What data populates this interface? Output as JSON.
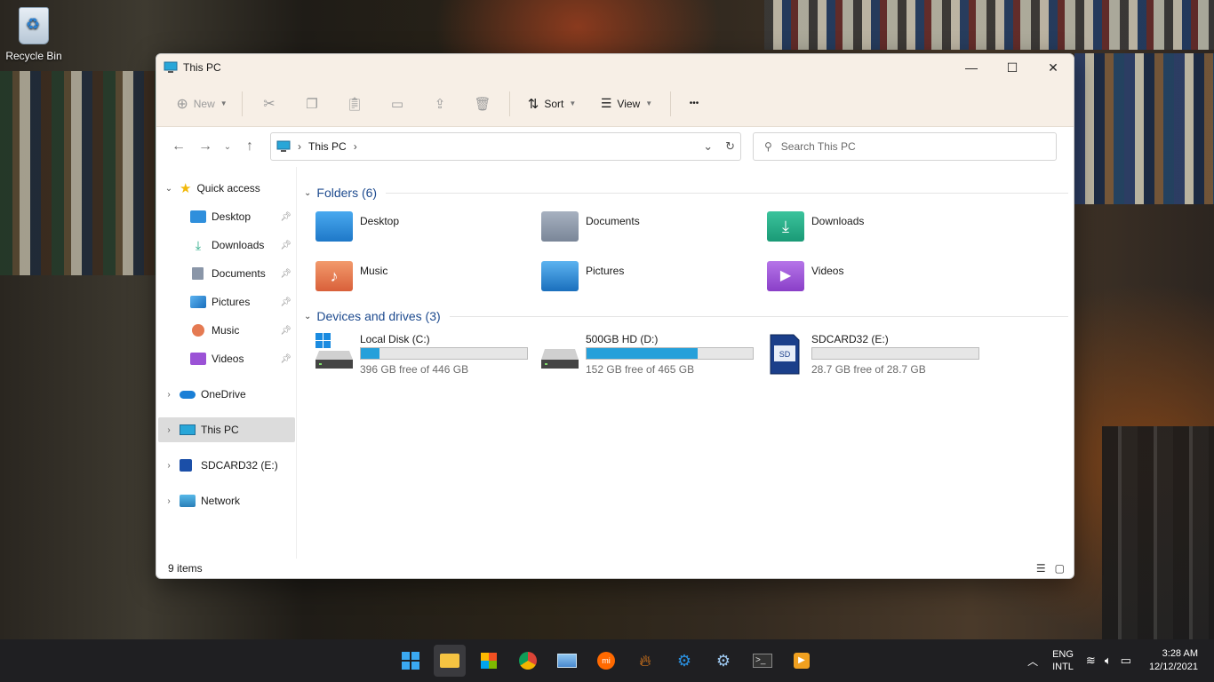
{
  "desktop": {
    "recycle_bin_label": "Recycle Bin"
  },
  "window": {
    "title": "This PC",
    "controls": {
      "minimize": "—",
      "maximize": "☐",
      "close": "✕"
    }
  },
  "toolbar": {
    "new_label": "New",
    "sort_label": "Sort",
    "view_label": "View",
    "more_label": "•••"
  },
  "address": {
    "crumb": "This PC",
    "search_placeholder": "Search This PC"
  },
  "nav": {
    "quick_access": "Quick access",
    "items": [
      {
        "label": "Desktop"
      },
      {
        "label": "Downloads"
      },
      {
        "label": "Documents"
      },
      {
        "label": "Pictures"
      },
      {
        "label": "Music"
      },
      {
        "label": "Videos"
      }
    ],
    "onedrive": "OneDrive",
    "this_pc": "This PC",
    "sdcard": "SDCARD32 (E:)",
    "network": "Network"
  },
  "folders": {
    "heading": "Folders (6)",
    "items": [
      {
        "name": "Desktop",
        "color": "#2f8fdc"
      },
      {
        "name": "Documents",
        "color": "#8a96a8"
      },
      {
        "name": "Downloads",
        "color": "#22a883"
      },
      {
        "name": "Music",
        "color": "#e57a52"
      },
      {
        "name": "Pictures",
        "color": "#2c8ad6"
      },
      {
        "name": "Videos",
        "color": "#9b52d6"
      }
    ]
  },
  "drives": {
    "heading": "Devices and drives (3)",
    "items": [
      {
        "name": "Local Disk (C:)",
        "free": "396 GB free of 446 GB",
        "used_fraction": 0.11
      },
      {
        "name": "500GB HD (D:)",
        "free": "152 GB free of 465 GB",
        "used_fraction": 0.67
      },
      {
        "name": "SDCARD32 (E:)",
        "free": "28.7 GB free of 28.7 GB",
        "used_fraction": 0.0
      }
    ]
  },
  "status": {
    "item_count": "9 items"
  },
  "taskbar": {
    "lang_top": "ENG",
    "lang_bottom": "INTL",
    "time": "3:28 AM",
    "date": "12/12/2021"
  }
}
